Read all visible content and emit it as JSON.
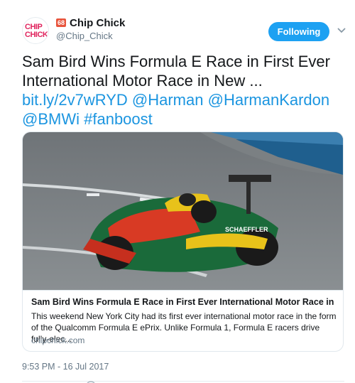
{
  "author": {
    "display_name": "Chip Chick",
    "handle": "@Chip_Chick",
    "avatar_line1": "CHIP",
    "avatar_line2": "CHICK",
    "brand_icon_text": "68"
  },
  "follow_button": {
    "label": "Following"
  },
  "tweet": {
    "text_line1": "Sam Bird Wins Formula E Race in First Ever",
    "text_line2": "International Motor Race in New ...",
    "link": "bit.ly/2v7wRYD",
    "mention1": "@Harman",
    "mention2": "@HarmanKardon",
    "mention3": "@BMWi",
    "hashtag": "#fanboost"
  },
  "card": {
    "title": "Sam Bird Wins Formula E Race in First Ever International Motor Race in New ...",
    "description": "This weekend New York City had its first ever international motor race in the form of the Qualcomm Formula E ePrix. Unlike Formula 1, Formula E racers drive fully-elec...",
    "domain": "chipchick.com",
    "car_text": "SCHAEFFLER"
  },
  "timestamp": "9:53 PM - 16 Jul 2017",
  "colors": {
    "link": "#1b95e0",
    "button": "#1da1f2",
    "muted": "#657786"
  }
}
